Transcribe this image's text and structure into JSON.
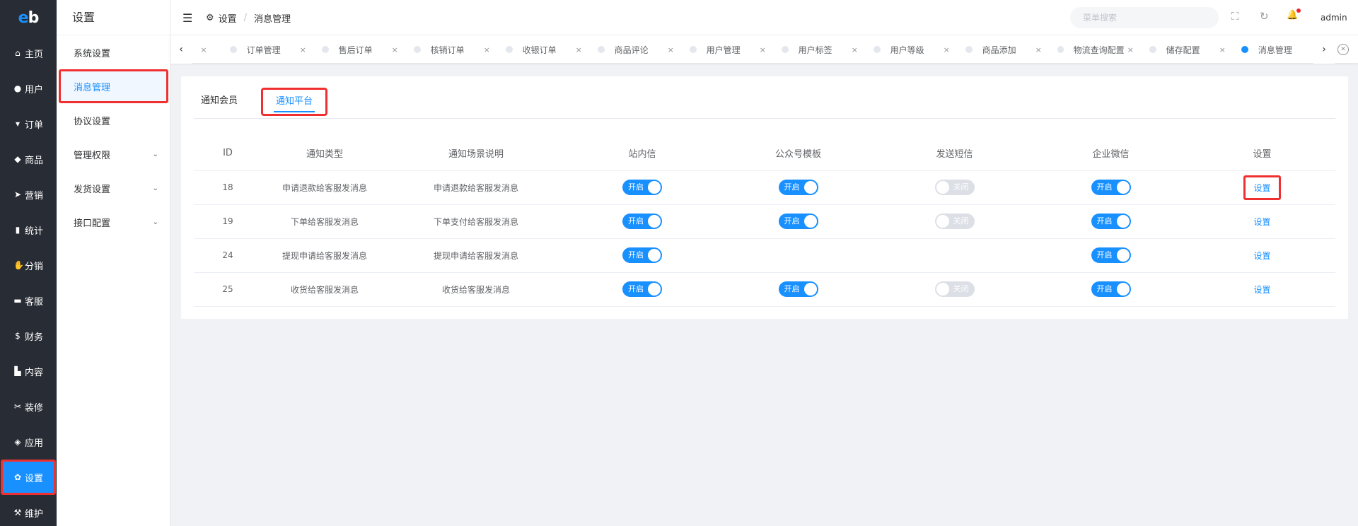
{
  "logo": {
    "e": "e",
    "b": "b"
  },
  "left_nav": [
    {
      "icon": "home-icon",
      "glyph": "⌂",
      "label": "主页"
    },
    {
      "icon": "user-icon",
      "glyph": "●",
      "label": "用户"
    },
    {
      "icon": "cart-icon",
      "glyph": "▾",
      "label": "订单"
    },
    {
      "icon": "basket-icon",
      "glyph": "◆",
      "label": "商品"
    },
    {
      "icon": "send-icon",
      "glyph": "➤",
      "label": "营销"
    },
    {
      "icon": "chart-icon",
      "glyph": "▮",
      "label": "统计"
    },
    {
      "icon": "handshake-icon",
      "glyph": "✋",
      "label": "分销"
    },
    {
      "icon": "chat-icon",
      "glyph": "▬",
      "label": "客服"
    },
    {
      "icon": "dollar-icon",
      "glyph": "$",
      "label": "财务"
    },
    {
      "icon": "book-icon",
      "glyph": "▙",
      "label": "内容"
    },
    {
      "icon": "tools-icon",
      "glyph": "✂",
      "label": "装修"
    },
    {
      "icon": "cube-icon",
      "glyph": "◈",
      "label": "应用"
    },
    {
      "icon": "gear-icon",
      "glyph": "✿",
      "label": "设置"
    },
    {
      "icon": "hammer-icon",
      "glyph": "⚒",
      "label": "维护"
    }
  ],
  "sub_menu": {
    "title": "设置",
    "items": [
      {
        "label": "系统设置",
        "chevron": ""
      },
      {
        "label": "消息管理",
        "chevron": ""
      },
      {
        "label": "协议设置",
        "chevron": ""
      },
      {
        "label": "管理权限",
        "chevron": "⌄"
      },
      {
        "label": "发货设置",
        "chevron": "⌄"
      },
      {
        "label": "接口配置",
        "chevron": "⌄"
      }
    ]
  },
  "header": {
    "hamburger": "☰",
    "gear": "⚙",
    "crumb1": "设置",
    "sep": "/",
    "crumb2": "消息管理",
    "search_placeholder": "菜单搜索",
    "fullscreen": "⛶",
    "refresh": "↻",
    "bell": "🔔",
    "user": "admin"
  },
  "tags": {
    "left_arrow": "‹",
    "right_arrow": "›",
    "first_x": "×",
    "items": [
      {
        "label": "订单管理",
        "x": "×"
      },
      {
        "label": "售后订单",
        "x": "×"
      },
      {
        "label": "核销订单",
        "x": "×"
      },
      {
        "label": "收银订单",
        "x": "×"
      },
      {
        "label": "商品评论",
        "x": "×"
      },
      {
        "label": "用户管理",
        "x": "×"
      },
      {
        "label": "用户标签",
        "x": "×"
      },
      {
        "label": "用户等级",
        "x": "×"
      },
      {
        "label": "商品添加",
        "x": "×"
      },
      {
        "label": "物流查询配置",
        "x": "×"
      },
      {
        "label": "储存配置",
        "x": "×"
      },
      {
        "label": "消息管理",
        "x": ""
      }
    ],
    "close_all": "✕"
  },
  "tabs": {
    "member": "通知会员",
    "platform": "通知平台"
  },
  "table": {
    "headers": [
      "ID",
      "通知类型",
      "通知场景说明",
      "站内信",
      "公众号模板",
      "发送短信",
      "企业微信",
      "设置"
    ],
    "on_label": "开启",
    "off_label": "关闭",
    "action_label": "设置",
    "rows": [
      {
        "id": "18",
        "type": "申请退款给客服发消息",
        "desc": "申请退款给客服发消息",
        "site": "on",
        "wechat": "on",
        "sms": "off",
        "work": "on"
      },
      {
        "id": "19",
        "type": "下单给客服发消息",
        "desc": "下单支付给客服发消息",
        "site": "on",
        "wechat": "on",
        "sms": "off",
        "work": "on"
      },
      {
        "id": "24",
        "type": "提现申请给客服发消息",
        "desc": "提现申请给客服发消息",
        "site": "on",
        "wechat": "",
        "sms": "",
        "work": "on"
      },
      {
        "id": "25",
        "type": "收货给客服发消息",
        "desc": "收货给客服发消息",
        "site": "on",
        "wechat": "on",
        "sms": "off",
        "work": "on"
      }
    ]
  },
  "colors": {
    "primary": "#1890ff",
    "nav_bg": "#282c34",
    "highlight": "#f03030"
  }
}
